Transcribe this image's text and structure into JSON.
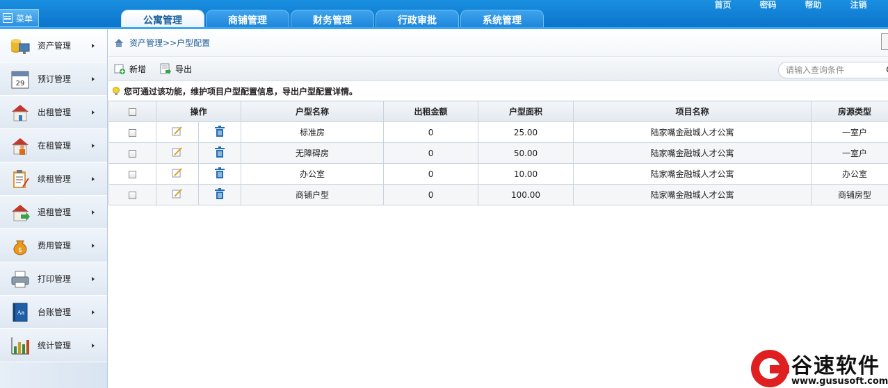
{
  "header": {
    "menu_label": "菜单",
    "tabs": [
      {
        "label": "公寓管理",
        "active": true
      },
      {
        "label": "商铺管理",
        "active": false
      },
      {
        "label": "财务管理",
        "active": false
      },
      {
        "label": "行政审批",
        "active": false
      },
      {
        "label": "系统管理",
        "active": false
      }
    ],
    "links": [
      "首页",
      "密码",
      "帮助",
      "注销"
    ]
  },
  "sidebar": {
    "items": [
      {
        "label": "资产管理",
        "icon": "coins-monitor-icon"
      },
      {
        "label": "预订管理",
        "icon": "calendar-icon",
        "icon_text": "29"
      },
      {
        "label": "出租管理",
        "icon": "house-out-icon"
      },
      {
        "label": "在租管理",
        "icon": "house-person-icon"
      },
      {
        "label": "续租管理",
        "icon": "clipboard-icon"
      },
      {
        "label": "退租管理",
        "icon": "house-return-icon"
      },
      {
        "label": "费用管理",
        "icon": "money-bag-icon"
      },
      {
        "label": "打印管理",
        "icon": "printer-icon"
      },
      {
        "label": "台账管理",
        "icon": "ledger-book-icon",
        "icon_text": "Aa"
      },
      {
        "label": "统计管理",
        "icon": "bar-chart-icon"
      }
    ]
  },
  "breadcrumb": "资产管理>>户型配置",
  "toolbar": {
    "add_label": "新增",
    "export_label": "导出",
    "search_placeholder": "请输入查询条件"
  },
  "tip": "您可通过该功能，维护项目户型配置信息，导出户型配置详情。",
  "table": {
    "headers": {
      "actions": "操作",
      "room_type": "户型名称",
      "rent": "出租金额",
      "area": "户型面积",
      "project": "项目名称",
      "source_type": "房源类型"
    },
    "rows": [
      {
        "room_type": "标准房",
        "rent": "0",
        "area": "25.00",
        "project": "陆家嘴金融城人才公寓",
        "source_type": "一室户"
      },
      {
        "room_type": "无障碍房",
        "rent": "0",
        "area": "50.00",
        "project": "陆家嘴金融城人才公寓",
        "source_type": "一室户"
      },
      {
        "room_type": "办公室",
        "rent": "0",
        "area": "10.00",
        "project": "陆家嘴金融城人才公寓",
        "source_type": "办公室"
      },
      {
        "room_type": "商铺户型",
        "rent": "0",
        "area": "100.00",
        "project": "陆家嘴金融城人才公寓",
        "source_type": "商铺房型"
      }
    ]
  },
  "watermark": {
    "brand": "谷速软件",
    "url": "www.gususoft.com"
  },
  "colors": {
    "topbar": "#0a72c9",
    "accent": "#1d5b95",
    "watermark_red": "#e02020"
  }
}
